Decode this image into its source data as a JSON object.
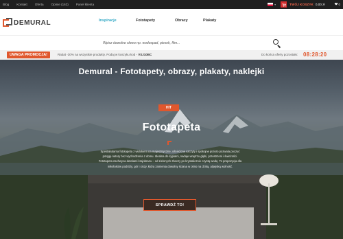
{
  "topbar": {
    "links": [
      "Blog",
      "Kontakt",
      "Oferta",
      "Opinie (163)",
      "Panel klienta"
    ],
    "cart_label": "TWÓJ KOSZYK",
    "cart_value": "0,00 zł",
    "wishlist_count": "0"
  },
  "header": {
    "logo_text": "DEMURAL",
    "nav": [
      "Inspiracje",
      "Fototapety",
      "Obrazy",
      "Plakaty"
    ]
  },
  "search": {
    "placeholder": "Wpisz dowolne słowo np. wodospad, piesek, film..."
  },
  "promo": {
    "badge": "UWAGA PROMOCJA!",
    "text": "Rabat -30% na wszystkie produkty. Podaj w koszyku kod - ",
    "code": "VSJ10BC",
    "countdown_label": "Do końca oferty pozostało:",
    "countdown": "08:28:20"
  },
  "hero": {
    "title": "Demural - Fototapety, obrazy, plakaty, naklejki",
    "badge": "HIT",
    "product_title": "Fototapeta",
    "description": "Spektakularna fototapeta z widokiem na majestatyczne, ośnieżone szczyty i spokojne jezioro pozwala poczuć potęgę natury bez wychodzenia z domu. Idealna do sypialni, nadaje wnętrzu głębi, przestrzeni i świeżości. Fototapeta zachwyca detalami krajobrazu – od zielonych zboczy po krystalicznie czystą wodę. To propozycja dla miłośników podróży, gór i ciszy, która zamienia dowolny ściana w okno na dziką, alpejską wolność.",
    "cta": "SPRAWDŹ TO!"
  },
  "colors": {
    "accent": "#e0572d",
    "nav_active": "#2fa7c4",
    "topbar_bg": "#1f1f1f"
  }
}
